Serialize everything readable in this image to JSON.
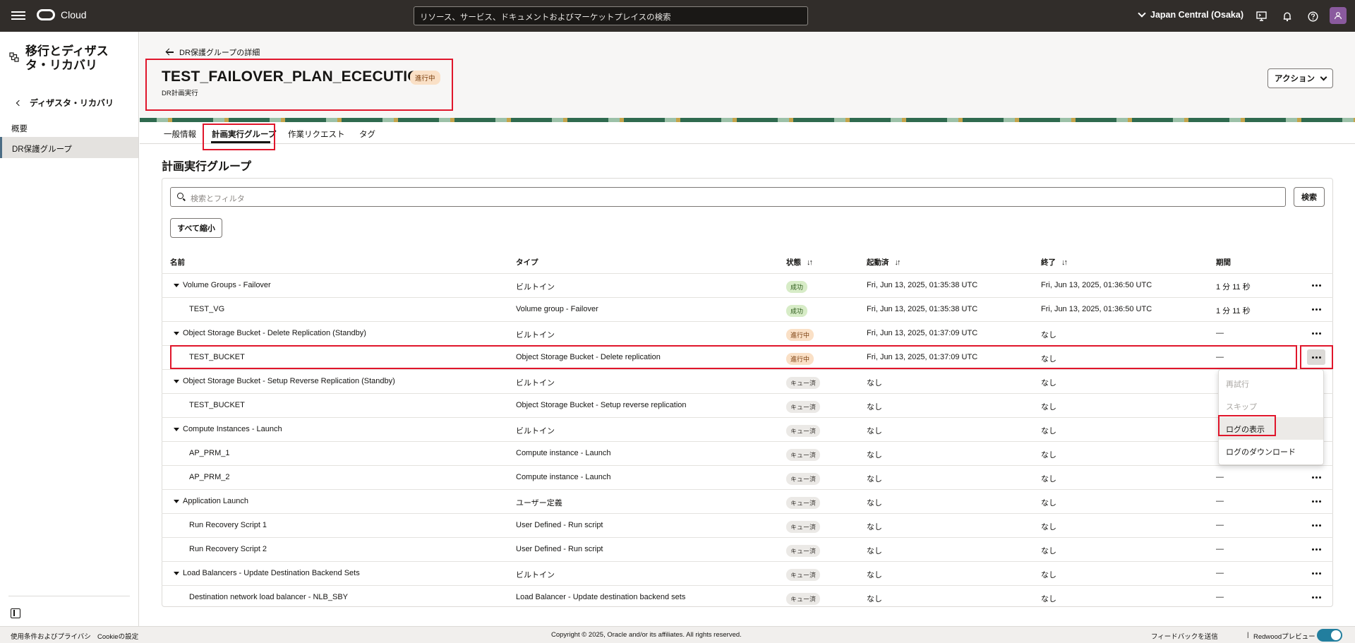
{
  "topbar": {
    "brand": "Cloud",
    "search_placeholder": "リソース、サービス、ドキュメントおよびマーケットプレイスの検索",
    "region": "Japan Central (Osaka)"
  },
  "sidebar": {
    "title": "移行とディザスタ・リカバリ",
    "back_label": "ディザスタ・リカバリ",
    "items": [
      {
        "label": "概要"
      },
      {
        "label": "DR保護グループ"
      }
    ]
  },
  "header": {
    "back_link": "DR保護グループの詳細",
    "title": "TEST_FAILOVER_PLAN_ECECUTION",
    "status_badge": "進行中",
    "subtitle": "DR計画実行",
    "actions_label": "アクション"
  },
  "tabs": [
    {
      "label": "一般情報"
    },
    {
      "label": "計画実行グループ"
    },
    {
      "label": "作業リクエスト"
    },
    {
      "label": "タグ"
    }
  ],
  "section": {
    "title": "計画実行グループ",
    "filter_placeholder": "検索とフィルタ",
    "search_button": "検索",
    "collapse_all_button": "すべて縮小"
  },
  "table": {
    "columns": [
      "名前",
      "タイプ",
      "状態",
      "起動済",
      "終了",
      "期間"
    ],
    "rows": [
      {
        "name": "Volume Groups - Failover",
        "type": "ビルトイン",
        "state": "成功",
        "started": "Fri, Jun 13, 2025, 01:35:38 UTC",
        "ended": "Fri, Jun 13, 2025, 01:36:50 UTC",
        "duration": "1 分 11 秒"
      },
      {
        "name": "TEST_VG",
        "type": "Volume group - Failover",
        "state": "成功",
        "started": "Fri, Jun 13, 2025, 01:35:38 UTC",
        "ended": "Fri, Jun 13, 2025, 01:36:50 UTC",
        "duration": "1 分 11 秒"
      },
      {
        "name": "Object Storage Bucket - Delete Replication (Standby)",
        "type": "ビルトイン",
        "state": "進行中",
        "started": "Fri, Jun 13, 2025, 01:37:09 UTC",
        "ended": "なし",
        "duration": "—"
      },
      {
        "name": "TEST_BUCKET",
        "type": "Object Storage Bucket - Delete replication",
        "state": "進行中",
        "started": "Fri, Jun 13, 2025, 01:37:09 UTC",
        "ended": "なし",
        "duration": "—"
      },
      {
        "name": "Object Storage Bucket - Setup Reverse Replication (Standby)",
        "type": "ビルトイン",
        "state": "キュー済",
        "started": "なし",
        "ended": "なし",
        "duration": ""
      },
      {
        "name": "TEST_BUCKET",
        "type": "Object Storage Bucket - Setup reverse replication",
        "state": "キュー済",
        "started": "なし",
        "ended": "なし",
        "duration": ""
      },
      {
        "name": "Compute Instances - Launch",
        "type": "ビルトイン",
        "state": "キュー済",
        "started": "なし",
        "ended": "なし",
        "duration": ""
      },
      {
        "name": "AP_PRM_1",
        "type": "Compute instance - Launch",
        "state": "キュー済",
        "started": "なし",
        "ended": "なし",
        "duration": ""
      },
      {
        "name": "AP_PRM_2",
        "type": "Compute instance - Launch",
        "state": "キュー済",
        "started": "なし",
        "ended": "なし",
        "duration": "—"
      },
      {
        "name": "Application Launch",
        "type": "ユーザー定義",
        "state": "キュー済",
        "started": "なし",
        "ended": "なし",
        "duration": "—"
      },
      {
        "name": "Run Recovery Script 1",
        "type": "User Defined - Run script",
        "state": "キュー済",
        "started": "なし",
        "ended": "なし",
        "duration": "—"
      },
      {
        "name": "Run Recovery Script 2",
        "type": "User Defined - Run script",
        "state": "キュー済",
        "started": "なし",
        "ended": "なし",
        "duration": "—"
      },
      {
        "name": "Load Balancers - Update Destination Backend Sets",
        "type": "ビルトイン",
        "state": "キュー済",
        "started": "なし",
        "ended": "なし",
        "duration": "—"
      },
      {
        "name": "Destination network load balancer - NLB_SBY",
        "type": "Load Balancer - Update destination backend sets",
        "state": "キュー済",
        "started": "なし",
        "ended": "なし",
        "duration": "—"
      }
    ]
  },
  "row_menu": {
    "items": [
      {
        "label": "再試行",
        "enabled": false
      },
      {
        "label": "スキップ",
        "enabled": false
      },
      {
        "label": "ログの表示",
        "enabled": true
      },
      {
        "label": "ログのダウンロード",
        "enabled": true
      }
    ]
  },
  "footer": {
    "terms": "使用条件およびプライバシ",
    "cookie": "Cookieの設定",
    "copyright": "Copyright © 2025, Oracle and/or its affiliates. All rights reserved.",
    "feedback": "フィードバックを送信",
    "separator": "|",
    "preview": "Redwoodプレビュー"
  },
  "colors": {
    "topbar": "#312d2a",
    "highlight": "#e0162b",
    "success": "#d7ecc7",
    "in_progress": "#fae0c6",
    "queued": "#ebe9e6"
  }
}
